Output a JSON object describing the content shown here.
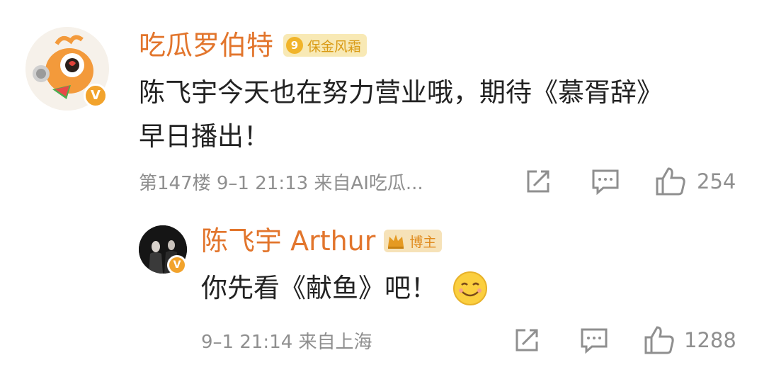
{
  "comment": {
    "username": "吃瓜罗伯特",
    "badge_level": "9",
    "badge_label": "保金风霜",
    "text_line1": "陈飞宇今天也在努力营业哦，期待《慕胥辞》",
    "text_line2": "早日播出！",
    "meta": "第147楼  9–1  21:13  来自AI吃瓜...",
    "like_count": "254"
  },
  "reply": {
    "username": "陈飞宇 Arthur",
    "badge_label": "博主",
    "text": "你先看《献鱼》吧！",
    "meta": "9–1  21:14  来自上海",
    "like_count": "1288"
  },
  "icons": {
    "share": "share-icon",
    "comment": "comment-icon",
    "like": "like-icon",
    "verified": "verified-badge-icon",
    "smile": "smile-emoji-icon"
  },
  "colors": {
    "username": "#e2752c",
    "text": "#222222",
    "meta": "#8f8f8f",
    "badge_bg": "#f8e9b5",
    "verified": "#f2a32c"
  }
}
